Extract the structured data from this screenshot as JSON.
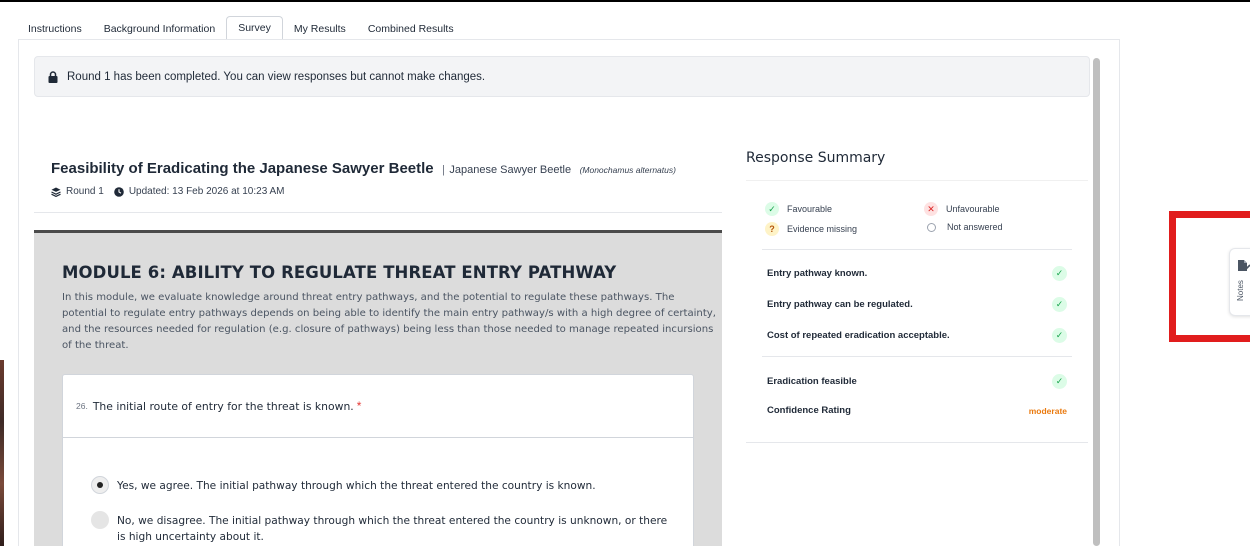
{
  "tabs": [
    {
      "label": "Instructions",
      "active": false
    },
    {
      "label": "Background Information",
      "active": false
    },
    {
      "label": "Survey",
      "active": true
    },
    {
      "label": "My Results",
      "active": false
    },
    {
      "label": "Combined Results",
      "active": false
    }
  ],
  "banner": {
    "icon": "lock-icon",
    "text": "Round 1 has been completed. You can view responses but cannot make changes."
  },
  "header": {
    "title": "Feasibility of Eradicating the Japanese Sawyer Beetle",
    "separator": "|",
    "common_name": "Japanese Sawyer Beetle",
    "scientific_name": "(Monochamus alternatus)",
    "round": "Round 1",
    "updated": "Updated: 13 Feb 2026 at 10:23 AM"
  },
  "module": {
    "title": "MODULE 6: ABILITY TO REGULATE THREAT ENTRY PATHWAY",
    "description": "In this module, we evaluate knowledge around threat entry pathways, and the potential to regulate these pathways. The potential to regulate entry pathways depends on being able to identify the main entry pathway/s with a high degree of certainty, and the resources needed for regulation (e.g. closure of pathways) being less than those needed to manage repeated incursions of the threat."
  },
  "question": {
    "number": "26.",
    "text": "The initial route of entry for the threat is known.",
    "required_marker": "*",
    "options": [
      {
        "text": "Yes, we agree. The initial pathway through which the threat entered the country is known.",
        "selected": true
      },
      {
        "text": "No, we disagree. The initial pathway through which the threat entered the country is unknown, or there is high uncertainty about it.",
        "selected": false
      }
    ]
  },
  "summary": {
    "title": "Response Summary",
    "legend": {
      "favourable": "Favourable",
      "unfavourable": "Unfavourable",
      "evidence_missing": "Evidence missing",
      "not_answered": "Not answered"
    },
    "items": [
      {
        "label": "Entry pathway known.",
        "status": "favourable"
      },
      {
        "label": "Entry pathway can be regulated.",
        "status": "favourable"
      },
      {
        "label": "Cost of repeated eradication acceptable.",
        "status": "favourable"
      }
    ],
    "eradication_feasible": {
      "label": "Eradication feasible",
      "status": "favourable"
    },
    "confidence": {
      "label": "Confidence Rating",
      "value": "moderate"
    }
  },
  "notes_tab": {
    "label": "Notes",
    "icon": "note-edit-icon"
  },
  "colors": {
    "favourable": "#16a34a",
    "unfavourable": "#dc2626",
    "evidence_missing": "#b45309",
    "moderate": "#ea7a0f",
    "highlight": "#e11d1d",
    "required": "#e53935"
  }
}
